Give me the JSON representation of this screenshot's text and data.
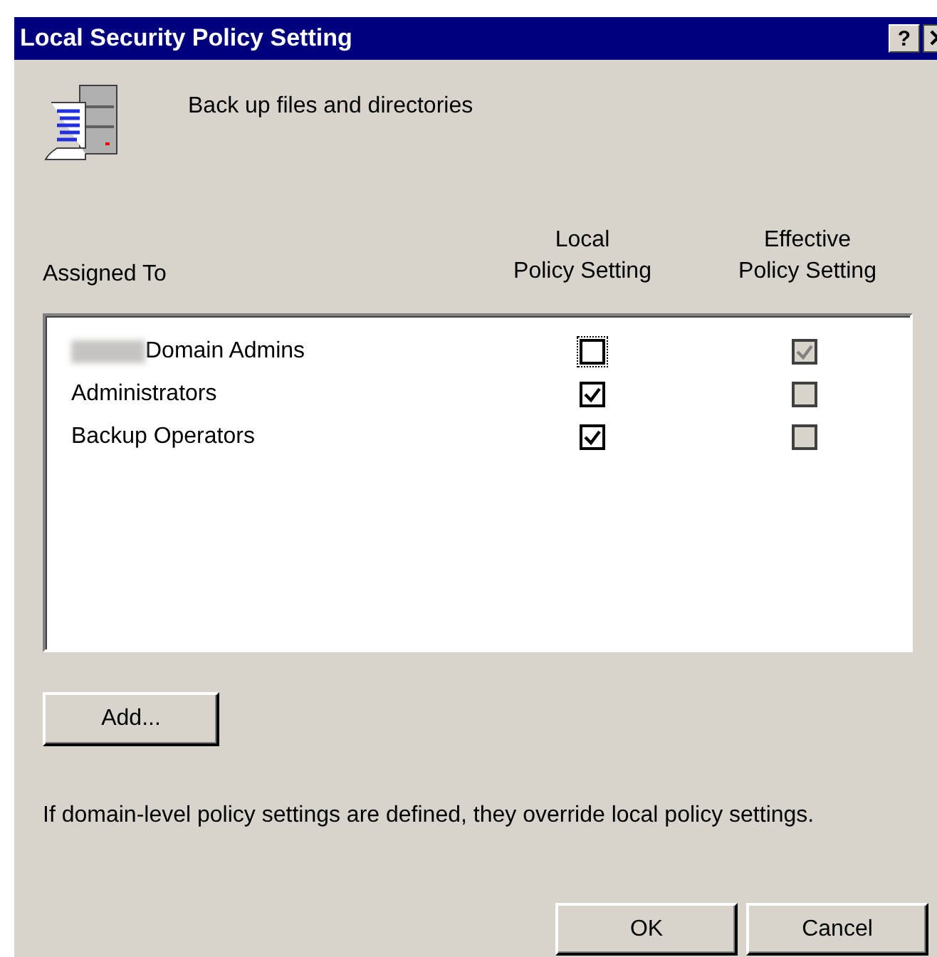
{
  "window": {
    "title": "Local Security Policy Setting",
    "help_button": "?"
  },
  "policy": {
    "name": "Back up files and directories"
  },
  "columns": {
    "assigned_to": "Assigned To",
    "local": [
      "Local",
      "Policy Setting"
    ],
    "effective": [
      "Effective",
      "Policy Setting"
    ]
  },
  "rows": [
    {
      "name": "Domain Admins",
      "redacted_prefix": true,
      "local_checked": false,
      "local_focused": true,
      "effective_checked": true
    },
    {
      "name": "Administrators",
      "redacted_prefix": false,
      "local_checked": true,
      "local_focused": false,
      "effective_checked": false
    },
    {
      "name": "Backup Operators",
      "redacted_prefix": false,
      "local_checked": true,
      "local_focused": false,
      "effective_checked": false
    }
  ],
  "add_button": "Add...",
  "note": "If domain-level policy settings are defined, they override local policy settings.",
  "buttons": [
    "OK",
    "Cancel"
  ]
}
